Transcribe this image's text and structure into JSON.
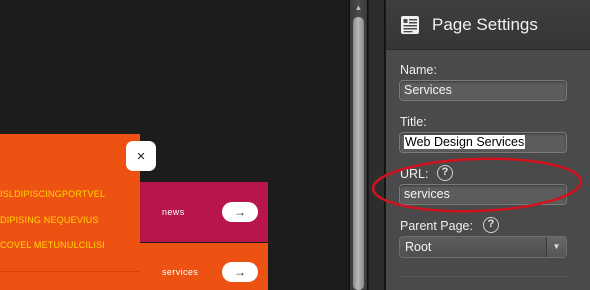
{
  "canvas": {
    "text_lines": [
      "ISLDIPISCINGPORTVEL",
      "DIPISING NEQUEVIUS",
      "COVEL METUNULCILISI"
    ],
    "close_glyph": "×",
    "nav": [
      {
        "label": "news",
        "arrow_glyph": "→",
        "color": "#b8154a"
      },
      {
        "label": "services",
        "arrow_glyph": "→",
        "color": "#ee5213"
      }
    ],
    "accent_orange": "#ee5213",
    "text_yellow": "#ffd600"
  },
  "scrollbar": {
    "up_glyph": "▲"
  },
  "panel": {
    "header_icon": "page-document-icon",
    "title": "Page Settings",
    "name_label": "Name:",
    "name_value": "Services",
    "title_label": "Title:",
    "title_value": "Web Design Services",
    "url_label": "URL:",
    "url_value": "services",
    "parent_label": "Parent Page:",
    "parent_value": "Root",
    "help_glyph": "?",
    "select_glyph": "▼"
  },
  "annotation": {
    "color": "#d4121f"
  }
}
